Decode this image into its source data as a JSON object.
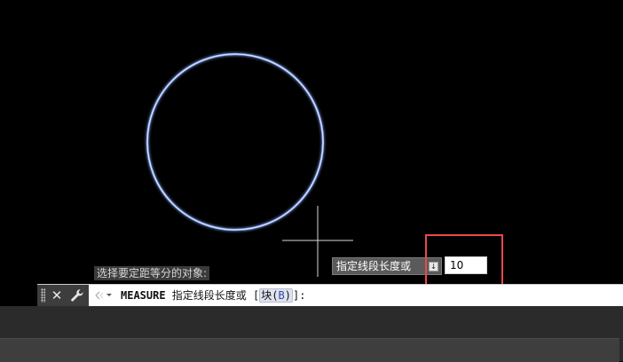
{
  "canvas": {
    "circle_color": "#8fb0ff",
    "crosshair_color": "#d9d9d9"
  },
  "prompt_history": {
    "text": "选择要定距等分的对象:"
  },
  "dynamic_input": {
    "label": "指定线段长度或",
    "dropdown_icon": "down-arrow-icon",
    "value": "10",
    "highlight_color": "#e84a4a"
  },
  "command_line": {
    "command_name": "MEASURE",
    "prompt": " 指定线段长度或 [",
    "option_text": "块(",
    "option_key": "B",
    "option_close": ")",
    "suffix": "]:",
    "icons": {
      "grip": "grip-handle-icon",
      "close": "close-icon",
      "customize": "wrench-icon",
      "recent": "recent-commands-icon"
    }
  }
}
